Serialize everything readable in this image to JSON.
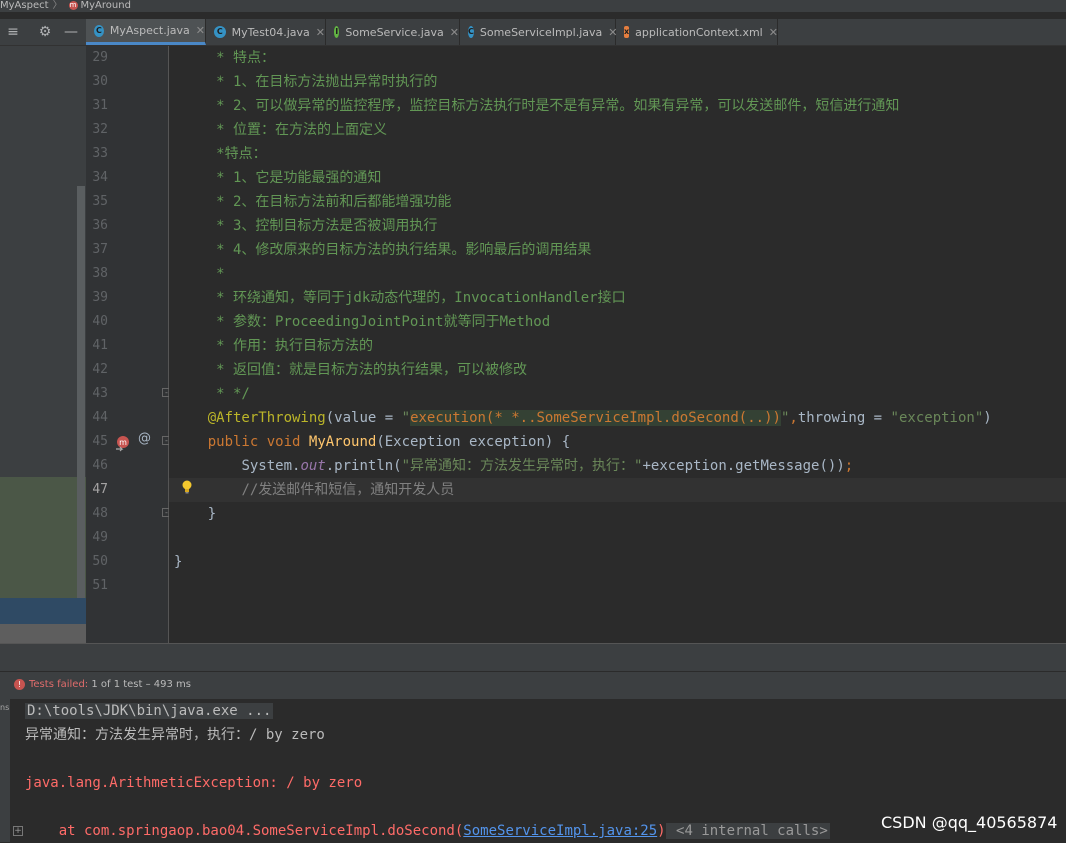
{
  "breadcrumb": {
    "class_name": "MyAspect",
    "separator": "〉",
    "method_name": "MyAround"
  },
  "toolbar": {
    "layout_icon": "≡",
    "settings_icon": "⚙",
    "hide_icon": "—"
  },
  "tabs": [
    {
      "label": "MyAspect.java",
      "icon_letter": "C",
      "icon_color": "#3592c4",
      "active": true
    },
    {
      "label": "MyTest04.java",
      "icon_letter": "C",
      "icon_color": "#3592c4",
      "active": false
    },
    {
      "label": "SomeService.java",
      "icon_letter": "I",
      "icon_color": "#62b543",
      "active": false
    },
    {
      "label": "SomeServiceImpl.java",
      "icon_letter": "C",
      "icon_color": "#3592c4",
      "active": false
    },
    {
      "label": "applicationContext.xml",
      "icon_letter": "x",
      "icon_color": "#e57e3f",
      "active": false
    }
  ],
  "editor": {
    "line_numbers": [
      "29",
      "30",
      "31",
      "32",
      "33",
      "34",
      "35",
      "36",
      "37",
      "38",
      "39",
      "40",
      "41",
      "42",
      "43",
      "44",
      "45",
      "46",
      "47",
      "48",
      "49",
      "50",
      "51"
    ],
    "current_line": "47",
    "doc_lines": [
      "     * 特点：",
      "     * 1、在目标方法抛出异常时执行的",
      "     * 2、可以做异常的监控程序，监控目标方法执行时是不是有异常。如果有异常，可以发送邮件，短信进行通知",
      "     * 位置：在方法的上面定义",
      "     *特点：",
      "     * 1、它是功能最强的通知",
      "     * 2、在目标方法前和后都能增强功能",
      "     * 3、控制目标方法是否被调用执行",
      "     * 4、修改原来的目标方法的执行结果。影响最后的调用结果",
      "     *",
      "     * 环绕通知，等同于jdk动态代理的，InvocationHandler接口",
      "     * 参数：ProceedingJointPoint就等同于Method",
      "     * 作用：执行目标方法的",
      "     * 返回值：就是目标方法的执行结果，可以被修改",
      "     * */"
    ],
    "l44": {
      "indent": "    ",
      "annotation": "@AfterThrowing",
      "open": "(",
      "param1": "value",
      "eq1": " = ",
      "q1": "\"",
      "pointcut": "execution(* *..SomeServiceImpl.doSecond(..))",
      "q2": "\"",
      "comma": ",",
      "param2": "throwing",
      "eq2": " = ",
      "val2": "\"exception\"",
      "close": ")"
    },
    "l45": {
      "indent": "    ",
      "kw_public": "public",
      "kw_void": "void",
      "method": "MyAround",
      "params": "(Exception exception) {"
    },
    "l46": {
      "indent": "        ",
      "system": "System.",
      "out": "out",
      "println": ".println(",
      "string": "\"异常通知：方法发生异常时，执行：\"",
      "rest": "+exception.getMessage())",
      "semi": ";"
    },
    "l47": {
      "indent": "        ",
      "comment": "//发送邮件和短信，通知开发人员"
    },
    "l48": "    }",
    "l50": "}",
    "gutter_at_symbol": "@"
  },
  "run": {
    "status_fail": "Tests failed:",
    "status_rest": " 1 of 1 test – 493 ms"
  },
  "console": {
    "side_label": "ns",
    "cmd": "D:\\tools\\JDK\\bin\\java.exe ...",
    "output1": "异常通知：方法发生异常时，执行：/ by zero",
    "exception": "java.lang.ArithmeticException: / by zero",
    "stack_prefix": "    at com.springaop.bao04.SomeServiceImpl.doSecond(",
    "stack_link": "SomeServiceImpl.java:25",
    "stack_close": ")",
    "internal": " <4 internal calls>"
  },
  "watermark": "CSDN @qq_40565874"
}
